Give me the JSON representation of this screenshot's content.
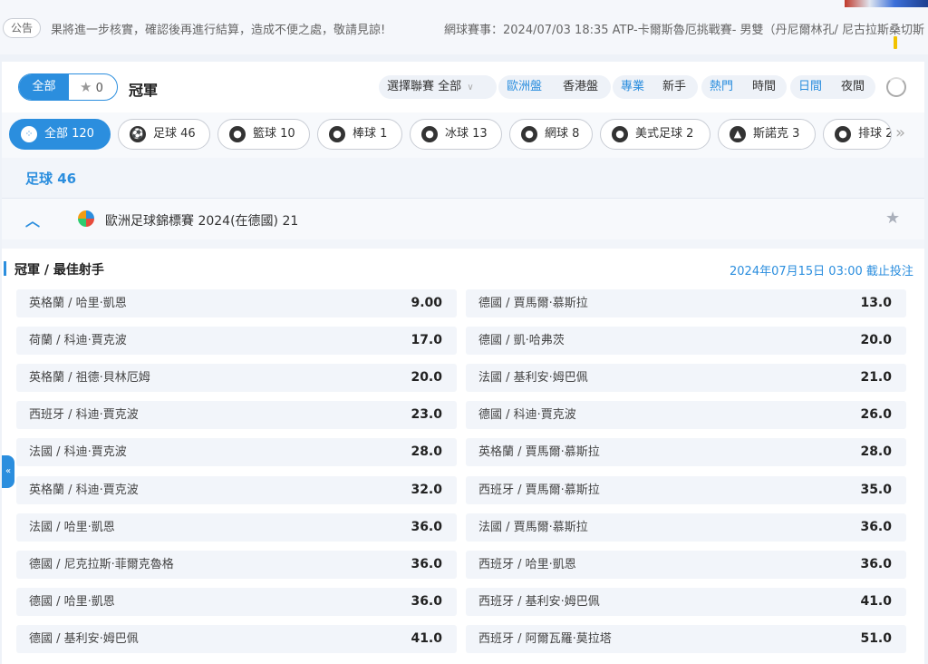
{
  "notice": {
    "tag": "公告",
    "text1": "果將進一步核實，確認後再進行結算，造成不便之處，敬請見諒!",
    "text2": "網球賽事：2024/07/03 18:35 ATP-卡爾斯魯厄挑戰賽- 男雙（丹尼爾林孔/ 尼古拉斯桑切斯"
  },
  "toolbar": {
    "all_label": "全部",
    "fav_count": "0",
    "title": "冠軍",
    "league_filter_label": "選擇聯賽",
    "league_filter_value": "全部",
    "odds_euro": "歐洲盤",
    "odds_hk": "香港盤",
    "mode_pro": "專業",
    "mode_novice": "新手",
    "sort_hot": "熱門",
    "sort_time": "時間",
    "theme_day": "日間",
    "theme_night": "夜間"
  },
  "sports": [
    {
      "label": "全部 120",
      "icon": "grid-icon",
      "active": true
    },
    {
      "label": "足球 46",
      "icon": "soccer-ball-icon"
    },
    {
      "label": "籃球 10",
      "icon": "basketball-icon"
    },
    {
      "label": "棒球 1",
      "icon": "baseball-icon"
    },
    {
      "label": "冰球 13",
      "icon": "hockey-puck-icon"
    },
    {
      "label": "網球 8",
      "icon": "tennis-ball-icon"
    },
    {
      "label": "美式足球 2",
      "icon": "american-football-icon"
    },
    {
      "label": "斯諾克 3",
      "icon": "snooker-balls-icon"
    },
    {
      "label": "排球 2",
      "icon": "volleyball-icon"
    }
  ],
  "section": {
    "title": "足球 46"
  },
  "league": {
    "name": "歐洲足球錦標賽 2024(在德國) 21"
  },
  "market": {
    "title": "冠軍 / 最佳射手",
    "deadline": "2024年07月15日 03:00 截止投注"
  },
  "odds": [
    {
      "sel": "英格蘭 / 哈里·凱恩",
      "odd": "9.00"
    },
    {
      "sel": "德國 / 賈馬爾·慕斯拉",
      "odd": "13.0"
    },
    {
      "sel": "荷蘭 / 科迪·賈克波",
      "odd": "17.0"
    },
    {
      "sel": "德國 / 凱·哈弗茨",
      "odd": "20.0"
    },
    {
      "sel": "英格蘭 / 祖德·貝林厄姆",
      "odd": "20.0"
    },
    {
      "sel": "法國 / 基利安·姆巴佩",
      "odd": "21.0"
    },
    {
      "sel": "西班牙 / 科迪·賈克波",
      "odd": "23.0"
    },
    {
      "sel": "德國 / 科迪·賈克波",
      "odd": "26.0"
    },
    {
      "sel": "法國 / 科迪·賈克波",
      "odd": "28.0"
    },
    {
      "sel": "英格蘭 / 賈馬爾·慕斯拉",
      "odd": "28.0"
    },
    {
      "sel": "英格蘭 / 科迪·賈克波",
      "odd": "32.0"
    },
    {
      "sel": "西班牙 / 賈馬爾·慕斯拉",
      "odd": "35.0"
    },
    {
      "sel": "法國 / 哈里·凱恩",
      "odd": "36.0"
    },
    {
      "sel": "法國 / 賈馬爾·慕斯拉",
      "odd": "36.0"
    },
    {
      "sel": "德國 / 尼克拉斯·菲爾克魯格",
      "odd": "36.0"
    },
    {
      "sel": "西班牙 / 哈里·凱恩",
      "odd": "36.0"
    },
    {
      "sel": "德國 / 哈里·凱恩",
      "odd": "36.0"
    },
    {
      "sel": "西班牙 / 基利安·姆巴佩",
      "odd": "41.0"
    },
    {
      "sel": "德國 / 基利安·姆巴佩",
      "odd": "41.0"
    },
    {
      "sel": "西班牙 / 阿爾瓦羅·莫拉塔",
      "odd": "51.0"
    }
  ],
  "colors": {
    "accent": "#2b8ede",
    "panel": "#f2f5fa",
    "cell": "#f2f5fa"
  }
}
